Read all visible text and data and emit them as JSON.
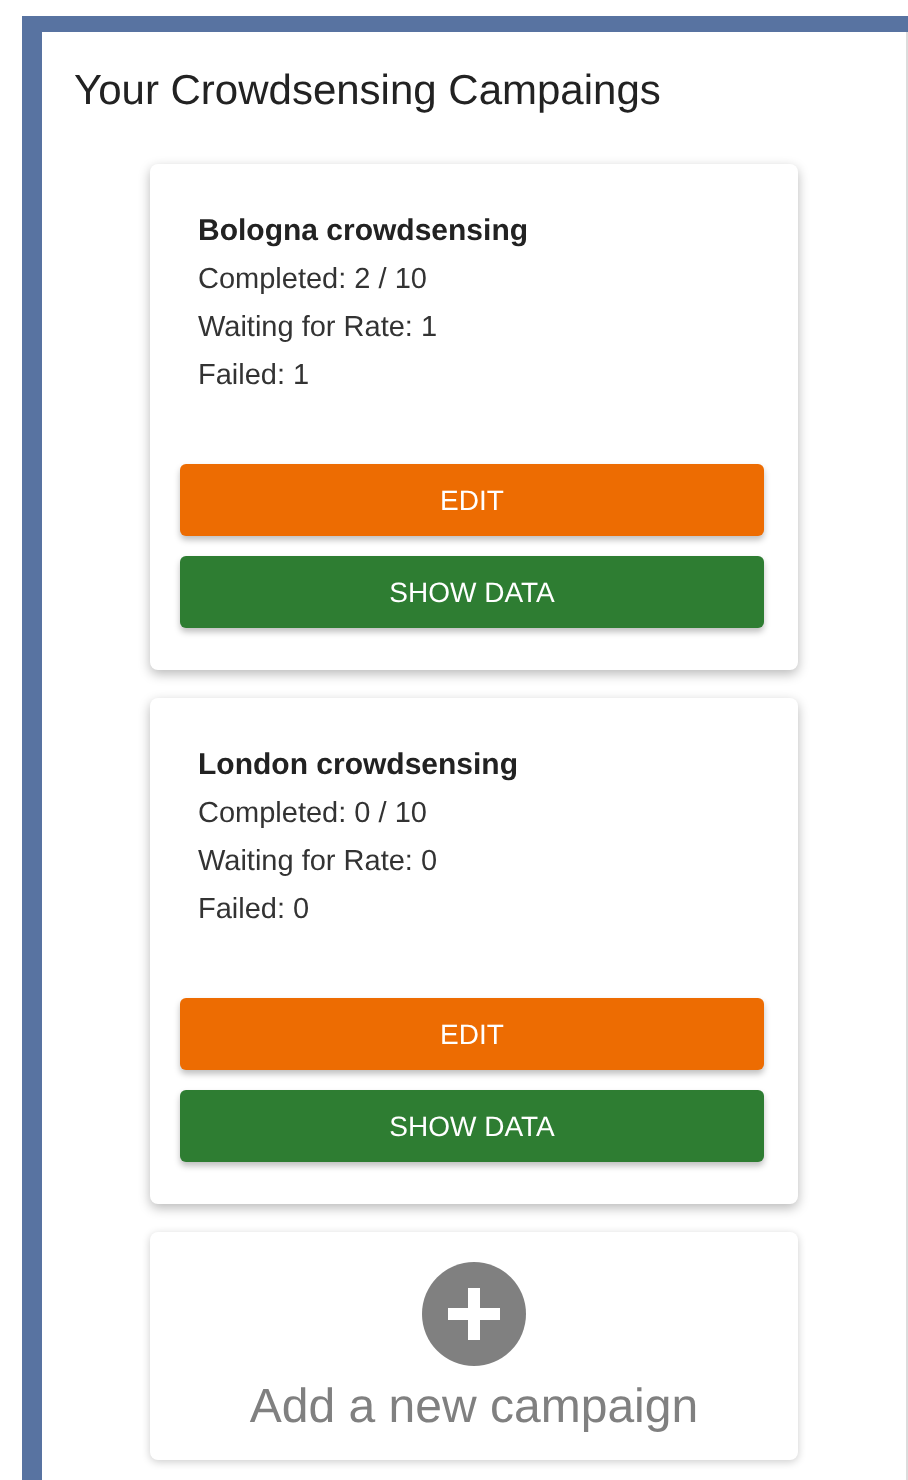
{
  "title": "Your Crowdsensing Campaings",
  "campaigns": [
    {
      "name": "Bologna crowdsensing",
      "stats": [
        "Completed: 2 / 10",
        "Waiting for Rate: 1",
        "Failed: 1"
      ],
      "buttons": [
        {
          "kind": "edit",
          "label": "EDIT"
        },
        {
          "kind": "show_data",
          "label": "SHOW DATA"
        }
      ]
    },
    {
      "name": "London crowdsensing",
      "stats": [
        "Completed: 0 / 10",
        "Waiting for Rate: 0",
        "Failed: 0"
      ],
      "buttons": [
        {
          "kind": "edit",
          "label": "EDIT"
        },
        {
          "kind": "show_data",
          "label": "SHOW DATA"
        }
      ]
    }
  ],
  "add_card": {
    "label": "Add a new campaign"
  }
}
